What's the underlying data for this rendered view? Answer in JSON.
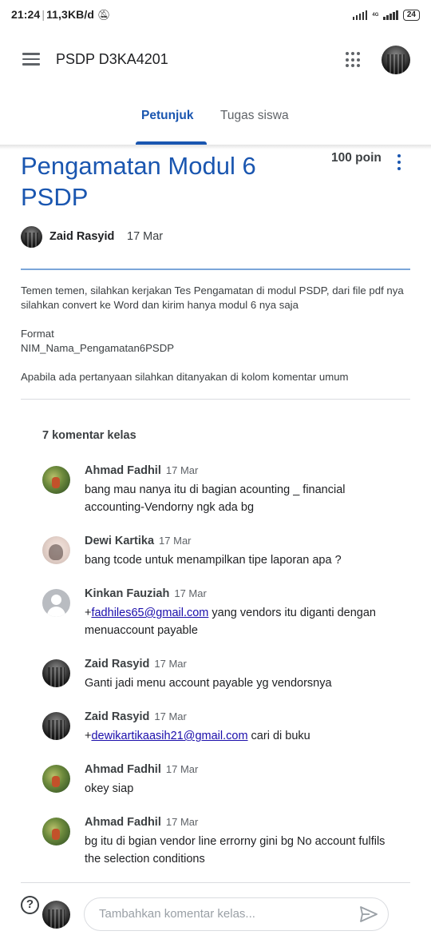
{
  "status_bar": {
    "time": "21:24",
    "speed": "11,3KB/d",
    "battery": "24",
    "network": "4G"
  },
  "app_bar": {
    "title": "PSDP D3KA4201"
  },
  "tabs": [
    {
      "label": "Petunjuk",
      "active": true
    },
    {
      "label": "Tugas siswa",
      "active": false
    }
  ],
  "assignment": {
    "title": "Pengamatan Modul 6 PSDP",
    "points": "100 poin",
    "author": "Zaid Rasyid",
    "date": "17 Mar",
    "description": {
      "line1": "Temen temen, silahkan kerjakan Tes Pengamatan di modul PSDP, dari file pdf nya silahkan convert ke Word dan kirim hanya modul 6 nya saja",
      "line2_a": "Format",
      "line2_b": "NIM_Nama_Pengamatan6PSDP",
      "line3": "Apabila ada pertanyaan silahkan ditanyakan di kolom komentar umum"
    }
  },
  "comments": {
    "count_label": "7 komentar kelas",
    "items": [
      {
        "name": "Ahmad Fadhil",
        "date": "17 Mar",
        "text": "bang mau nanya itu di bagian acounting _ financial accounting-Vendorny ngk ada bg"
      },
      {
        "name": "Dewi Kartika",
        "date": "17 Mar",
        "text": "bang tcode untuk menampilkan tipe laporan apa ?"
      },
      {
        "name": "Kinkan Fauziah",
        "date": "17 Mar",
        "prefix": "+",
        "link": "fadhiles65@gmail.com",
        "text": " yang vendors itu diganti dengan menuaccount payable"
      },
      {
        "name": "Zaid Rasyid",
        "date": "17 Mar",
        "text": "Ganti jadi menu account payable yg vendorsnya"
      },
      {
        "name": "Zaid Rasyid",
        "date": "17 Mar",
        "prefix": "+",
        "link": "dewikartikaasih21@gmail.com",
        "text": " cari di buku"
      },
      {
        "name": "Ahmad Fadhil",
        "date": "17 Mar",
        "text": "okey siap"
      },
      {
        "name": "Ahmad Fadhil",
        "date": "17 Mar",
        "text": "bg itu di bgian vendor line errorny gini bg No account fulfils the selection conditions"
      }
    ]
  },
  "compose": {
    "placeholder": "Tambahkan komentar kelas...",
    "help_icon": "?"
  },
  "icons": {
    "menu": "hamburger-icon",
    "apps": "apps-grid-icon",
    "more": "more-vert-icon",
    "help": "help-circle-icon",
    "send": "send-icon"
  },
  "colors": {
    "accent": "#1a56b0",
    "link": "#1a0dab",
    "divider": "#dadce0"
  }
}
